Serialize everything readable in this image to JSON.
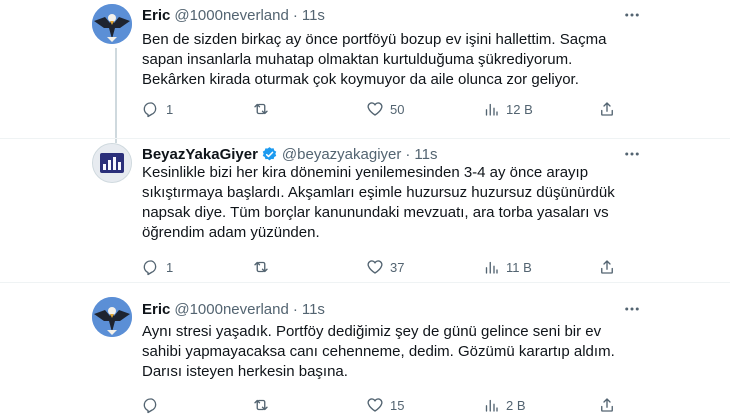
{
  "tweets": [
    {
      "name": "Eric",
      "handle": "@1000neverland",
      "dot": "·",
      "time": "11s",
      "text": "Ben de sizden birkaç ay önce portföyü bozup ev işini hallettim. Saçma sapan insanlarla muhatap olmaktan kurtulduğuma şükrediyorum. Bekârken kirada oturmak çok koymuyor da aile olunca zor geliyor.",
      "replies": "1",
      "retweets": "",
      "likes": "50",
      "views": "12 B"
    },
    {
      "name": "BeyazYakaGiyer",
      "handle": "@beyazyakagiyer",
      "dot": "·",
      "time": "11s",
      "text": "Kesinlikle bizi her kira dönemini yenilemesinden 3-4 ay önce arayıp sıkıştırmaya başlardı. Akşamları eşimle huzursuz huzursuz düşünürdük napsak diye. Tüm borçlar kanunundaki mevzuatı, ara torba yasaları vs öğrendim adam yüzünden.",
      "replies": "1",
      "retweets": "",
      "likes": "37",
      "views": "11 B"
    },
    {
      "name": "Eric",
      "handle": "@1000neverland",
      "dot": "·",
      "time": "11s",
      "text": "Aynı stresi yaşadık. Portföy dediğimiz şey de günü gelince seni bir ev sahibi yapmayacaksa canı cehenneme, dedim. Gözümü karartıp aldım. Darısı isteyen herkesin başına.",
      "replies": "",
      "retweets": "",
      "likes": "15",
      "views": "2 B"
    }
  ],
  "icons": {
    "reply": "reply-icon",
    "retweet": "retweet-icon",
    "like": "heart-icon",
    "views": "views-icon",
    "share": "share-icon",
    "more": "more-icon",
    "verified": "verified-badge-icon"
  },
  "colors": {
    "text": "#0f1419",
    "secondary": "#536471",
    "verified": "#1d9bf0",
    "divider": "#eff3f4"
  }
}
